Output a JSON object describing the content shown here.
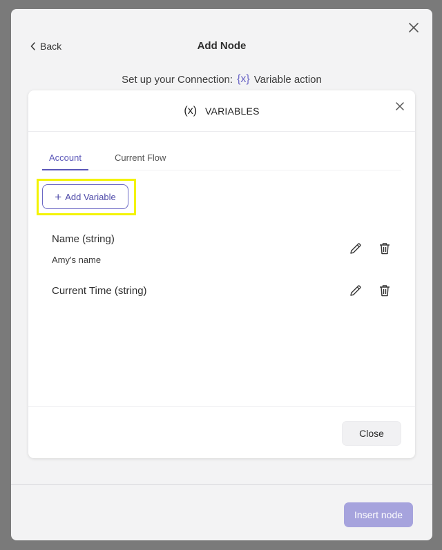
{
  "outer": {
    "back_label": "Back",
    "title": "Add Node",
    "connection_prefix": "Set up your Connection:",
    "connection_icon_glyph": "{x}",
    "connection_action": "Variable action",
    "insert_label": "Insert node"
  },
  "dialog": {
    "icon_glyph": "(x)",
    "title": "VARIABLES",
    "tabs": [
      {
        "label": "Account",
        "active": true
      },
      {
        "label": "Current Flow",
        "active": false
      }
    ],
    "add_label": "Add Variable",
    "variables": [
      {
        "name": "Name (string)",
        "value": "Amy's name"
      },
      {
        "name": "Current Time (string)",
        "value": ""
      }
    ],
    "close_label": "Close"
  },
  "colors": {
    "accent": "#5a56b8",
    "insert_button": "#a6a3dd",
    "highlight": "#f3f300"
  }
}
